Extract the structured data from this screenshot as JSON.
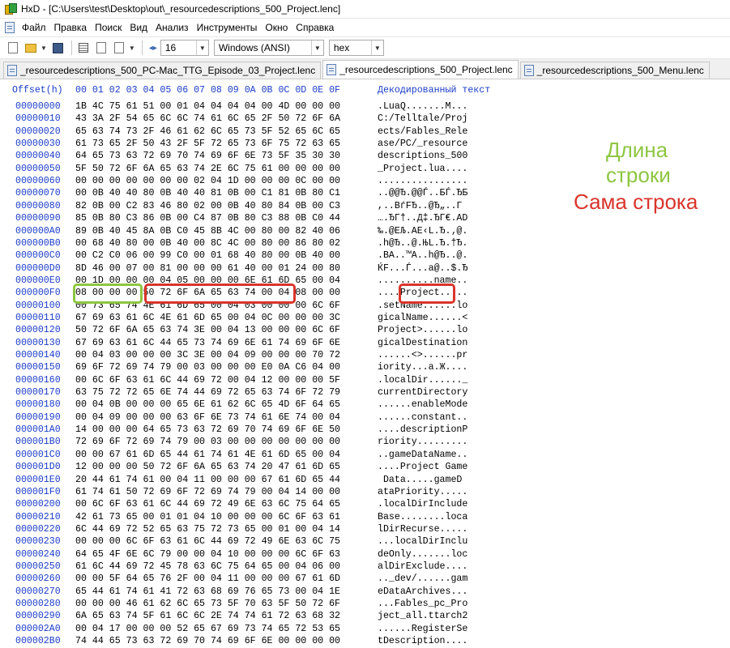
{
  "window": {
    "title": "HxD - [C:\\Users\\test\\Desktop\\out\\_resourcedescriptions_500_Project.lenc]"
  },
  "menu": [
    "Файл",
    "Правка",
    "Поиск",
    "Вид",
    "Анализ",
    "Инструменты",
    "Окно",
    "Справка"
  ],
  "toolbar": {
    "bytes_per_row": "16",
    "charset": "Windows (ANSI)",
    "offset_base": "hex"
  },
  "tabs": [
    {
      "label": "_resourcedescriptions_500_PC-Mac_TTG_Episode_03_Project.lenc",
      "active": false
    },
    {
      "label": "_resourcedescriptions_500_Project.lenc",
      "active": true
    },
    {
      "label": "_resourcedescriptions_500_Menu.lenc",
      "active": false
    }
  ],
  "header": {
    "offset": "Offset(h)",
    "columns": "00 01 02 03 04 05 06 07 08 09 0A 0B 0C 0D 0E 0F",
    "text": "Декодированный текст"
  },
  "rows": [
    {
      "offset": "00000000",
      "hex": "1B 4C 75 61 51 00 01 04 04 04 04 00 4D 00 00 00",
      "text": ".LuaQ.......M..."
    },
    {
      "offset": "00000010",
      "hex": "43 3A 2F 54 65 6C 6C 74 61 6C 65 2F 50 72 6F 6A",
      "text": "C:/Telltale/Proj"
    },
    {
      "offset": "00000020",
      "hex": "65 63 74 73 2F 46 61 62 6C 65 73 5F 52 65 6C 65",
      "text": "ects/Fables_Rele"
    },
    {
      "offset": "00000030",
      "hex": "61 73 65 2F 50 43 2F 5F 72 65 73 6F 75 72 63 65",
      "text": "ase/PC/_resource"
    },
    {
      "offset": "00000040",
      "hex": "64 65 73 63 72 69 70 74 69 6F 6E 73 5F 35 30 30",
      "text": "descriptions_500"
    },
    {
      "offset": "00000050",
      "hex": "5F 50 72 6F 6A 65 63 74 2E 6C 75 61 00 00 00 00",
      "text": "_Project.lua...."
    },
    {
      "offset": "00000060",
      "hex": "00 00 00 00 00 00 00 02 04 1D 00 00 00 0C 00 00",
      "text": "................"
    },
    {
      "offset": "00000070",
      "hex": "00 0B 40 40 80 0B 40 40 81 0B 00 C1 81 0B 80 C1",
      "text": "..@@Ђ.@@Ѓ..БЃ.ЂБ"
    },
    {
      "offset": "00000080",
      "hex": "82 0B 00 C2 83 46 80 02 00 0B 40 80 84 0B 00 C3",
      "text": ",..BѓFЂ..@Ђ„..Г"
    },
    {
      "offset": "00000090",
      "hex": "85 0B 80 C3 86 0B 00 C4 87 0B 80 C3 88 0B C0 44",
      "text": "….ЂГ†..Д‡.ЂГ€.АD"
    },
    {
      "offset": "000000A0",
      "hex": "89 0B 40 45 8A 0B C0 45 8B 4C 00 80 00 82 40 06",
      "text": "‰.@EЉ.AE‹L.Ђ.‚@."
    },
    {
      "offset": "000000B0",
      "hex": "00 68 40 80 00 0B 40 00 8C 4C 00 80 00 86 80 02",
      "text": ".h@Ђ..@.ЊL.Ђ.†Ђ."
    },
    {
      "offset": "000000C0",
      "hex": "00 C2 C0 06 00 99 C0 00 01 68 40 80 00 0B 40 00",
      "text": ".BA..™A..h@Ђ..@."
    },
    {
      "offset": "000000D0",
      "hex": "8D 46 00 07 00 81 00 00 00 61 40 00 01 24 00 80",
      "text": "ЌF...Ѓ...a@..$.Ђ"
    },
    {
      "offset": "000000E0",
      "hex": "00 1D 00 00 00 04 05 00 00 00 6E 61 6D 65 00 04",
      "text": "..........name.."
    },
    {
      "offset": "000000F0",
      "hex": "08 00 00 00 50 72 6F 6A 65 63 74 00 04 08 00 00",
      "text": "....Project....."
    },
    {
      "offset": "00000100",
      "hex": "00 73 65 74 4E 61 6D 65 00 04 03 00 00 00 6C 6F",
      "text": ".setName......lo"
    },
    {
      "offset": "00000110",
      "hex": "67 69 63 61 6C 4E 61 6D 65 00 04 0C 00 00 00 3C",
      "text": "gicalName......<"
    },
    {
      "offset": "00000120",
      "hex": "50 72 6F 6A 65 63 74 3E 00 04 13 00 00 00 6C 6F",
      "text": "Project>......lo"
    },
    {
      "offset": "00000130",
      "hex": "67 69 63 61 6C 44 65 73 74 69 6E 61 74 69 6F 6E",
      "text": "gicalDestination"
    },
    {
      "offset": "00000140",
      "hex": "00 04 03 00 00 00 3C 3E 00 04 09 00 00 00 70 72",
      "text": "......<>......pr"
    },
    {
      "offset": "00000150",
      "hex": "69 6F 72 69 74 79 00 03 00 00 00 E0 0A C6 04 00",
      "text": "iority...а.Ж...."
    },
    {
      "offset": "00000160",
      "hex": "00 6C 6F 63 61 6C 44 69 72 00 04 12 00 00 00 5F",
      "text": ".localDir......_"
    },
    {
      "offset": "00000170",
      "hex": "63 75 72 72 65 6E 74 44 69 72 65 63 74 6F 72 79",
      "text": "currentDirectory"
    },
    {
      "offset": "00000180",
      "hex": "00 04 0B 00 00 00 65 6E 61 62 6C 65 4D 6F 64 65",
      "text": "......enableMode"
    },
    {
      "offset": "00000190",
      "hex": "00 04 09 00 00 00 63 6F 6E 73 74 61 6E 74 00 04",
      "text": "......constant.."
    },
    {
      "offset": "000001A0",
      "hex": "14 00 00 00 64 65 73 63 72 69 70 74 69 6F 6E 50",
      "text": "....descriptionP"
    },
    {
      "offset": "000001B0",
      "hex": "72 69 6F 72 69 74 79 00 03 00 00 00 00 00 00 00",
      "text": "riority........."
    },
    {
      "offset": "000001C0",
      "hex": "00 00 67 61 6D 65 44 61 74 61 4E 61 6D 65 00 04",
      "text": "..gameDataName.."
    },
    {
      "offset": "000001D0",
      "hex": "12 00 00 00 50 72 6F 6A 65 63 74 20 47 61 6D 65",
      "text": "....Project Game"
    },
    {
      "offset": "000001E0",
      "hex": "20 44 61 74 61 00 04 11 00 00 00 67 61 6D 65 44",
      "text": " Data.....gameD"
    },
    {
      "offset": "000001F0",
      "hex": "61 74 61 50 72 69 6F 72 69 74 79 00 04 14 00 00",
      "text": "ataPriority....."
    },
    {
      "offset": "00000200",
      "hex": "00 6C 6F 63 61 6C 44 69 72 49 6E 63 6C 75 64 65",
      "text": ".localDirInclude"
    },
    {
      "offset": "00000210",
      "hex": "42 61 73 65 00 01 01 04 10 00 00 00 6C 6F 63 61",
      "text": "Base........loca"
    },
    {
      "offset": "00000220",
      "hex": "6C 44 69 72 52 65 63 75 72 73 65 00 01 00 04 14",
      "text": "lDirRecurse....."
    },
    {
      "offset": "00000230",
      "hex": "00 00 00 6C 6F 63 61 6C 44 69 72 49 6E 63 6C 75",
      "text": "...localDirInclu"
    },
    {
      "offset": "00000240",
      "hex": "64 65 4F 6E 6C 79 00 00 04 10 00 00 00 6C 6F 63",
      "text": "deOnly.......loc"
    },
    {
      "offset": "00000250",
      "hex": "61 6C 44 69 72 45 78 63 6C 75 64 65 00 04 06 00",
      "text": "alDirExclude...."
    },
    {
      "offset": "00000260",
      "hex": "00 00 5F 64 65 76 2F 00 04 11 00 00 00 67 61 6D",
      "text": ".._dev/......gam"
    },
    {
      "offset": "00000270",
      "hex": "65 44 61 74 61 41 72 63 68 69 76 65 73 00 04 1E",
      "text": "eDataArchives..."
    },
    {
      "offset": "00000280",
      "hex": "00 00 00 46 61 62 6C 65 73 5F 70 63 5F 50 72 6F",
      "text": "...Fables_pc_Pro"
    },
    {
      "offset": "00000290",
      "hex": "6A 65 63 74 5F 61 6C 6C 2E 74 74 61 72 63 68 32",
      "text": "ject_all.ttarch2"
    },
    {
      "offset": "000002A0",
      "hex": "00 04 17 00 00 00 52 65 67 69 73 74 65 72 53 65",
      "text": "......RegisterSe"
    },
    {
      "offset": "000002B0",
      "hex": "74 44 65 73 63 72 69 70 74 69 6F 6E 00 00 00 00",
      "text": "tDescription...."
    }
  ],
  "annotations": {
    "length_label": "Длина строки",
    "string_label": "Сама строка",
    "length_color": "#8ec641",
    "string_color": "#d9342b"
  }
}
